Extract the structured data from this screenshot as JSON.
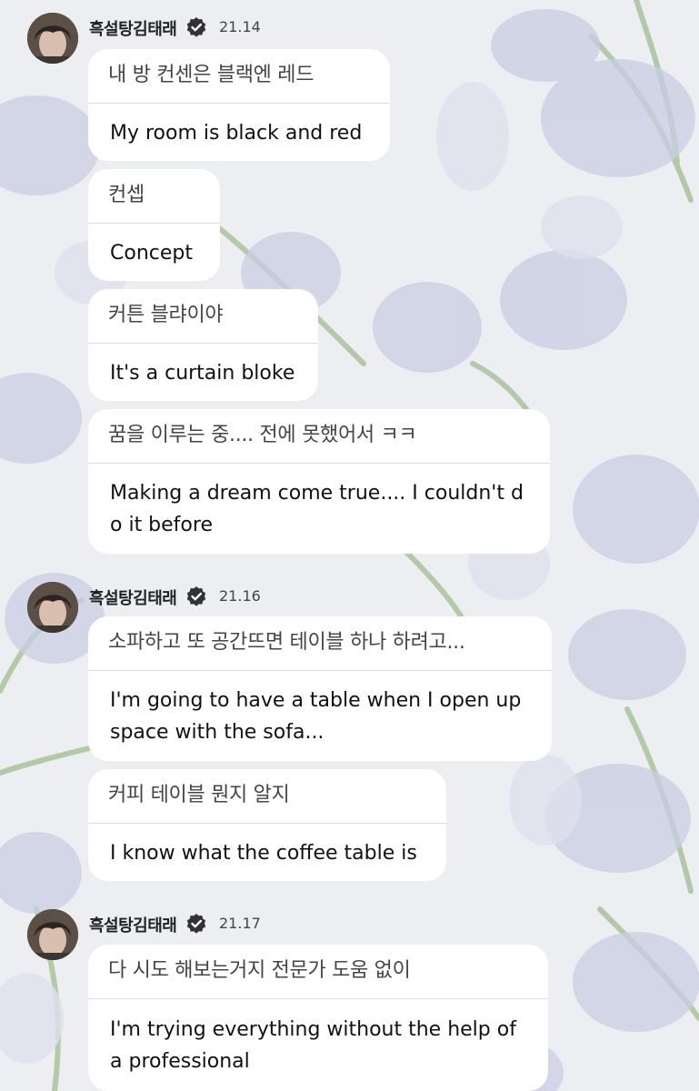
{
  "messages": [
    {
      "username": "흑설탕김태래",
      "time": "21.14",
      "bubbles": [
        {
          "ko": "내 방 컨센은 블랙엔 레드",
          "en": "My room is black and red"
        },
        {
          "ko": "컨셉",
          "en": "Concept"
        },
        {
          "ko": "커튼 블랴이야",
          "en": "It's a curtain bloke"
        },
        {
          "ko": "꿈을 이루는 중.... 전에 못했어서 ㅋㅋ",
          "en": "Making a dream come true.... I couldn't do it before"
        }
      ]
    },
    {
      "username": "흑설탕김태래",
      "time": "21.16",
      "bubbles": [
        {
          "ko": "소파하고 또 공간뜨면 테이블 하나 하려고...",
          "en": "I'm going to have a table when I open up space with the sofa..."
        },
        {
          "ko": "커피 테이블 뭔지 알지",
          "en": "I know what the coffee table is"
        }
      ]
    },
    {
      "username": "흑설탕김태래",
      "time": "21.17",
      "bubbles": [
        {
          "ko": "다 시도 해보는거지 전문가 도움 없이",
          "en": "I'm trying everything without the help of a professional"
        }
      ]
    }
  ],
  "colors": {
    "background": "#ebecf0",
    "flower": "#c9cde3",
    "stem": "#9fba8f",
    "bubble": "#ffffff"
  }
}
